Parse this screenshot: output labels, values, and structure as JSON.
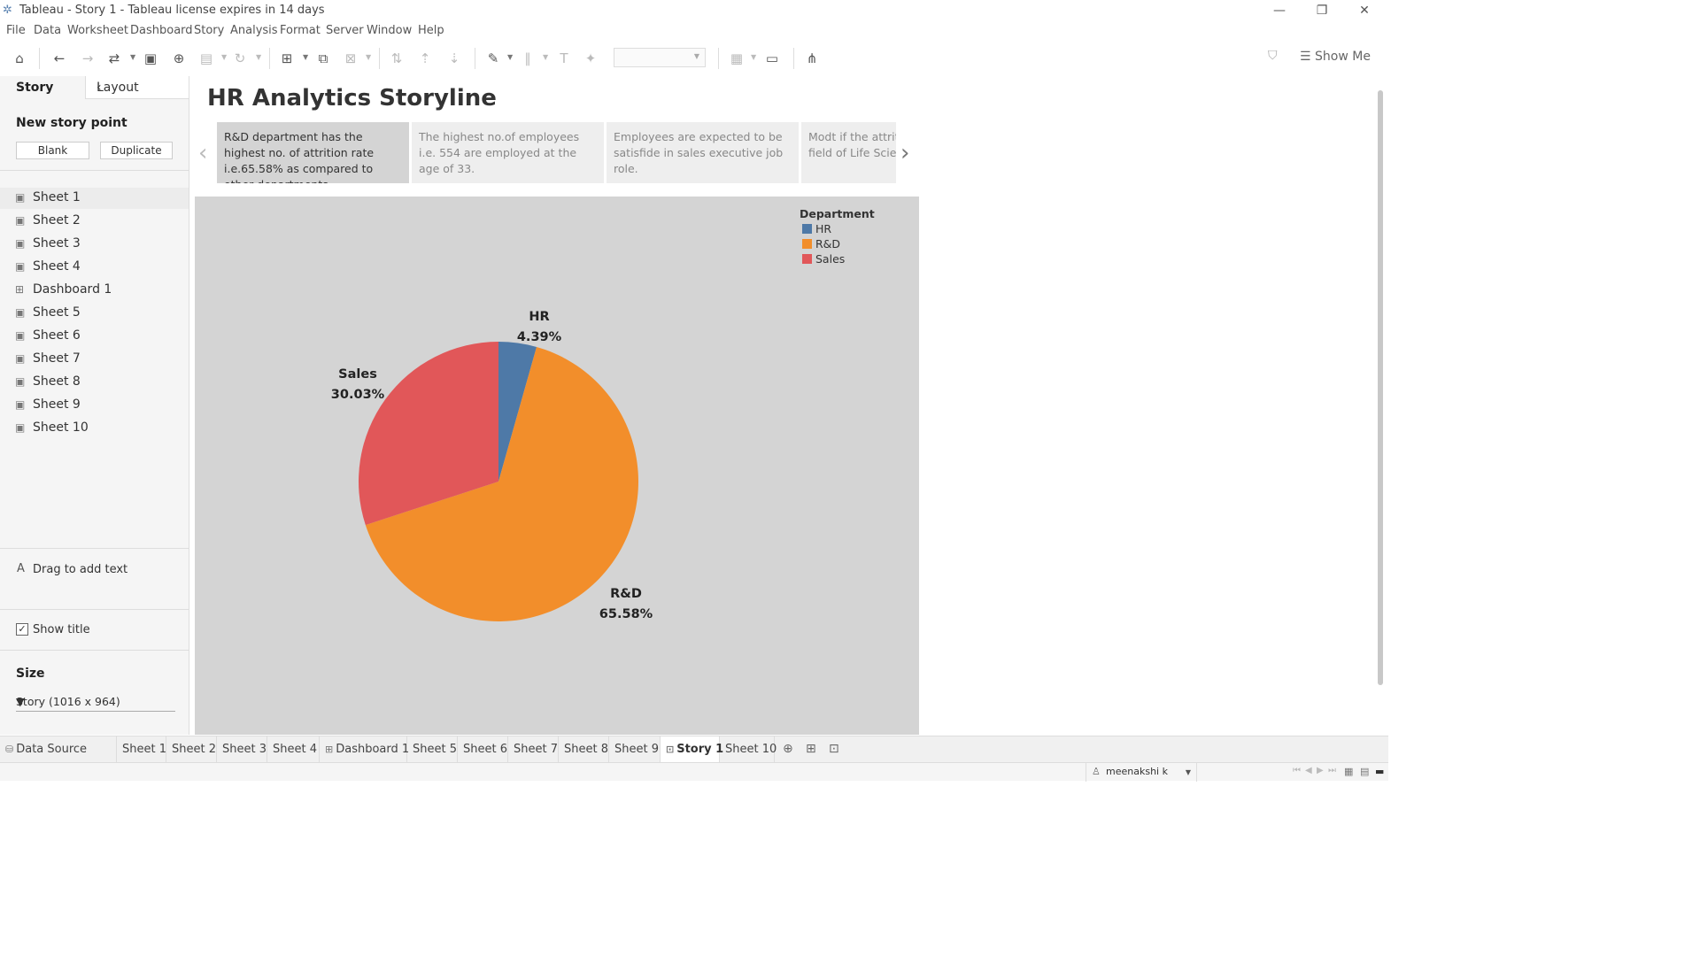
{
  "window": {
    "title": "Tableau - Story 1 - Tableau license expires in 14 days",
    "minimize": "—",
    "restore": "❐",
    "close": "✕"
  },
  "menu": [
    "File",
    "Data",
    "Worksheet",
    "Dashboard",
    "Story",
    "Analysis",
    "Format",
    "Server",
    "Window",
    "Help"
  ],
  "toolbar": {
    "show_me_label": "Show Me"
  },
  "left_panel": {
    "tabs": {
      "story": "Story",
      "layout": "Layout"
    },
    "new_story_point": "New story point",
    "blank_button": "Blank",
    "duplicate_button": "Duplicate",
    "sheets": [
      {
        "label": "Sheet 1",
        "icon": "worksheet-icon"
      },
      {
        "label": "Sheet 2",
        "icon": "worksheet-icon"
      },
      {
        "label": "Sheet 3",
        "icon": "worksheet-icon"
      },
      {
        "label": "Sheet 4",
        "icon": "worksheet-icon"
      },
      {
        "label": "Dashboard 1",
        "icon": "dashboard-icon"
      },
      {
        "label": "Sheet 5",
        "icon": "worksheet-icon"
      },
      {
        "label": "Sheet 6",
        "icon": "worksheet-icon"
      },
      {
        "label": "Sheet 7",
        "icon": "worksheet-icon"
      },
      {
        "label": "Sheet 8",
        "icon": "worksheet-icon"
      },
      {
        "label": "Sheet 9",
        "icon": "worksheet-icon"
      },
      {
        "label": "Sheet 10",
        "icon": "worksheet-icon"
      }
    ],
    "drag_text": "Drag to add text",
    "show_title_label": "Show title",
    "show_title_checked": true,
    "size_label": "Size",
    "size_value": "Story (1016 x 964)"
  },
  "story": {
    "title": "HR Analytics Storyline",
    "captions": [
      "R&D department has the highest no. of attrition rate i.e.65.58% as compared to other departments.",
      "The highest no.of employees i.e. 554 are employed at the age of 33.",
      "Employees are expected to be satisfide in sales executive job role.",
      "Modt if the attrition is from the field of Life Sciences."
    ],
    "active_caption_index": 0
  },
  "chart_data": {
    "type": "pie",
    "legend_title": "Department",
    "legend_position": "top-right",
    "slices": [
      {
        "name": "HR",
        "value": 4.39,
        "label": "4.39%",
        "color": "#4e79a7"
      },
      {
        "name": "R&D",
        "value": 65.58,
        "label": "65.58%",
        "color": "#f28e2b"
      },
      {
        "name": "Sales",
        "value": 30.03,
        "label": "30.03%",
        "color": "#e15759"
      }
    ]
  },
  "bottom_tabs": [
    {
      "label": "Data Source",
      "icon": "datasource-icon",
      "active": false
    },
    {
      "label": "Sheet 1",
      "active": false
    },
    {
      "label": "Sheet 2",
      "active": false
    },
    {
      "label": "Sheet 3",
      "active": false
    },
    {
      "label": "Sheet 4",
      "active": false
    },
    {
      "label": "Dashboard 1",
      "icon": "dashboard-icon",
      "active": false
    },
    {
      "label": "Sheet 5",
      "active": false
    },
    {
      "label": "Sheet 6",
      "active": false
    },
    {
      "label": "Sheet 7",
      "active": false
    },
    {
      "label": "Sheet 8",
      "active": false
    },
    {
      "label": "Sheet 9",
      "active": false
    },
    {
      "label": "Story 1",
      "icon": "story-icon",
      "active": true
    },
    {
      "label": "Sheet 10",
      "active": false
    }
  ],
  "status": {
    "user": "meenakshi k"
  }
}
